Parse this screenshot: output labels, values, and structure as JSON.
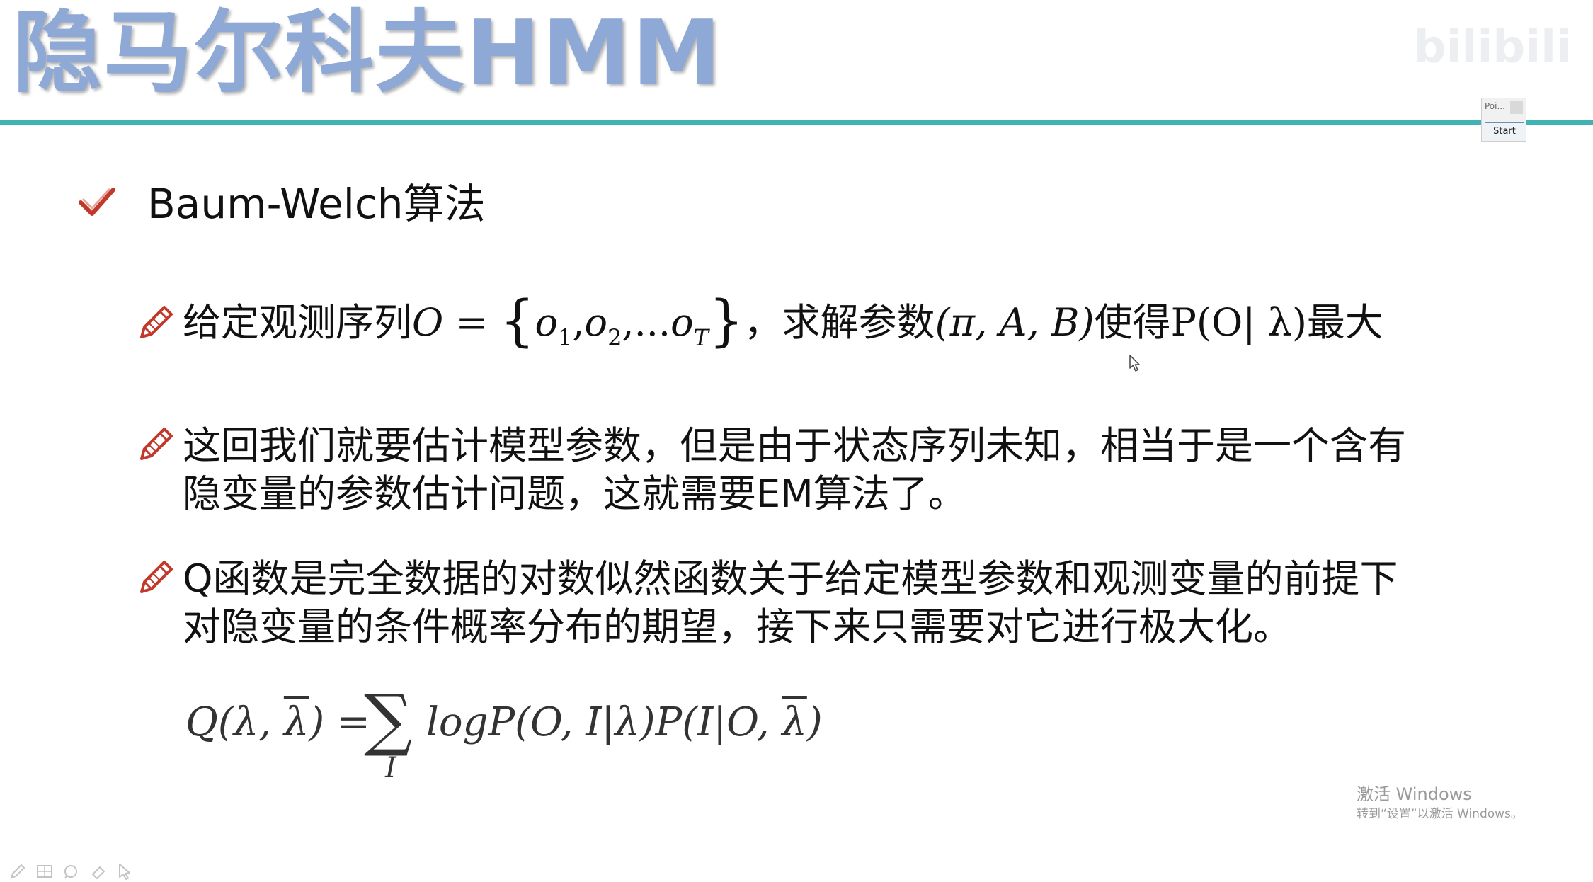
{
  "title": "隐马尔科夫HMM",
  "watermark": "bilibili",
  "player_widget": {
    "label": "Poi...",
    "start_label": "Start"
  },
  "heading": "Baum-Welch算法",
  "bullet1": {
    "prefix": "给定观测序列",
    "O": "O",
    "eq": " = ",
    "lbrace": "{",
    "o": "o",
    "sub1": "1",
    "sub2": "2",
    "dots": ",...",
    "subT": "T",
    "rbrace": "}",
    "middle": "，求解参数",
    "params": "(π, A, B)",
    "middle2": "使得",
    "prob": "P(O| λ)",
    "suffix": "最大"
  },
  "bullet2": {
    "line1": "这回我们就要估计模型参数，但是由于状态序列未知，相当于是一个含有",
    "line2": "隐变量的参数估计问题，这就需要EM算法了。"
  },
  "bullet3": {
    "line1": "Q函数是完全数据的对数似然函数关于给定模型参数和观测变量的前提下",
    "line2": "对隐变量的条件概率分布的期望，接下来只需要对它进行极大化。"
  },
  "formula": {
    "lhs_a": "Q(λ, ",
    "lambda_bar": "λ",
    "lhs_b": ") =",
    "sum_symbol": "∑",
    "sum_index": "I",
    "rhs_a": "logP(O, I|λ)P(I|O, ",
    "rhs_b": ")"
  },
  "activation": {
    "line1": "激活 Windows",
    "line2": "转到“设置”以激活 Windows。"
  },
  "colors": {
    "title": "#8fa9d7",
    "rule": "#3fb3b3",
    "check": "#c0392b",
    "pencil": "#c0392b"
  }
}
